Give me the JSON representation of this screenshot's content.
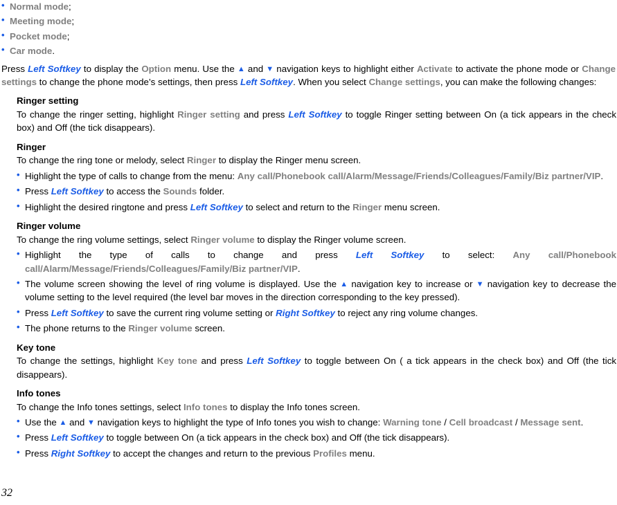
{
  "document": {
    "page_number": "32",
    "colors": {
      "link_blue": "#1a5ce6",
      "menu_gray": "#808080",
      "body_black": "#000000"
    },
    "mode_list": [
      {
        "name": "Normal mode",
        "punct": ";"
      },
      {
        "name": "Meeting mode",
        "punct": ";"
      },
      {
        "name": "Pocket mode",
        "punct": ";"
      },
      {
        "name": "Car mode",
        "punct": "."
      }
    ],
    "intro": {
      "t1": "Press ",
      "k1": "Left Softkey",
      "t2": " to display the ",
      "k2": "Option",
      "t3": " menu. Use the ",
      "arrow_up": "▲",
      "t4": " and ",
      "arrow_down": "▼",
      "t5": " navigation keys to highlight either ",
      "k3": "Activate",
      "t6": "  to activate the phone mode or ",
      "k4": "Change settings",
      "t7": " to change the phone mode’s settings, then press ",
      "k5": "Left Softkey",
      "t8": ". When you select ",
      "k6": "Change settings",
      "t9": ", you can make the following changes:"
    },
    "sections": [
      {
        "id": "ringer-setting",
        "heading": "Ringer setting",
        "lead": {
          "t1": "To change the ringer setting, highlight ",
          "k1": "Ringer setting",
          "t2": " and press ",
          "k2": "Left Softkey",
          "t3": " to toggle Ringer setting between On (a tick appears in the check box) and Off (the tick disappears)."
        },
        "bullets": []
      },
      {
        "id": "ringer",
        "heading": "Ringer",
        "lead": {
          "t1": "To change the ring tone or melody, select ",
          "k1": "Ringer",
          "t2": " to display the Ringer menu screen."
        },
        "bullets": [
          {
            "t1": "Highlight the type of calls to change from the menu: ",
            "k1": "Any call/Phonebook call/Alarm/Message/Friends/Colleagues/Family/Biz partner/VIP",
            "t2": "."
          },
          {
            "t1": "Press ",
            "b1": "Left Softkey",
            "t2": " to access the ",
            "k1": "Sounds",
            "t3": " folder."
          },
          {
            "t1": "Highlight the desired ringtone and press ",
            "b1": "Left Softkey",
            "t2": "  to select and return to the ",
            "k1": "Ringer",
            "t3": " menu screen."
          }
        ]
      },
      {
        "id": "ringer-volume",
        "heading": "Ringer volume",
        "lead": {
          "t1": "To change the ring volume settings, select ",
          "k1": "Ringer volume",
          "t2": " to display the Ringer volume screen."
        },
        "bullets": [
          {
            "t1": "Highlight the type of calls to change and press ",
            "b1": "Left Softkey",
            "t2": "  to select: ",
            "k1": "Any call/Phonebook call/Alarm/Message/Friends/Colleagues/Family/Biz partner/VIP",
            "t3": "."
          },
          {
            "t1": "The volume screen showing the level of ring volume is displayed. Use the ",
            "arrow_up": "▲",
            "t2": " navigation key to increase or ",
            "arrow_down": "▼",
            "t3": " navigation key to decrease the volume setting to the level required (the level bar moves in the direction corresponding to the key pressed)."
          },
          {
            "t1": "Press ",
            "b1": "Left Softkey",
            "t2": " to save the current ring volume setting or ",
            "b2": "Right Softkey",
            "t3": " to reject any ring volume changes."
          },
          {
            "t1": "The phone returns to the ",
            "k1": "Ringer volume",
            "t2": " screen."
          }
        ]
      },
      {
        "id": "key-tone",
        "heading": "Key tone",
        "lead": {
          "t1": "To change the settings, highlight ",
          "k1": "Key tone",
          "t2": " and press ",
          "k2": "Left Softkey",
          "t3": " to toggle between On ( a tick appears in the check box) and Off (the tick disappears)."
        },
        "bullets": []
      },
      {
        "id": "info-tones",
        "heading": "Info tones",
        "lead": {
          "t1": "To change the Info tones settings, select ",
          "k1": "Info tones",
          "t2": " to display the Info tones screen."
        },
        "bullets": [
          {
            "t1": "Use the ",
            "arrow_up": "▲",
            "t2": " and ",
            "arrow_down": "▼",
            "t3": " navigation keys to highlight the type of Info tones you wish to change: ",
            "k1": "Warning tone",
            "t4": " / ",
            "k2": "Cell broadcast",
            "t5": " / ",
            "k3": "Message sent",
            "t6": "."
          },
          {
            "t1": "Press ",
            "b1": "Left Softkey",
            "t2": " to toggle between On (a tick appears in the check box) and Off (the tick disappears)."
          },
          {
            "t1": "Press ",
            "b1": "Right Softkey",
            "t2": " to accept the changes and return to the previous ",
            "k1": "Profiles",
            "t3": " menu."
          }
        ]
      }
    ]
  }
}
